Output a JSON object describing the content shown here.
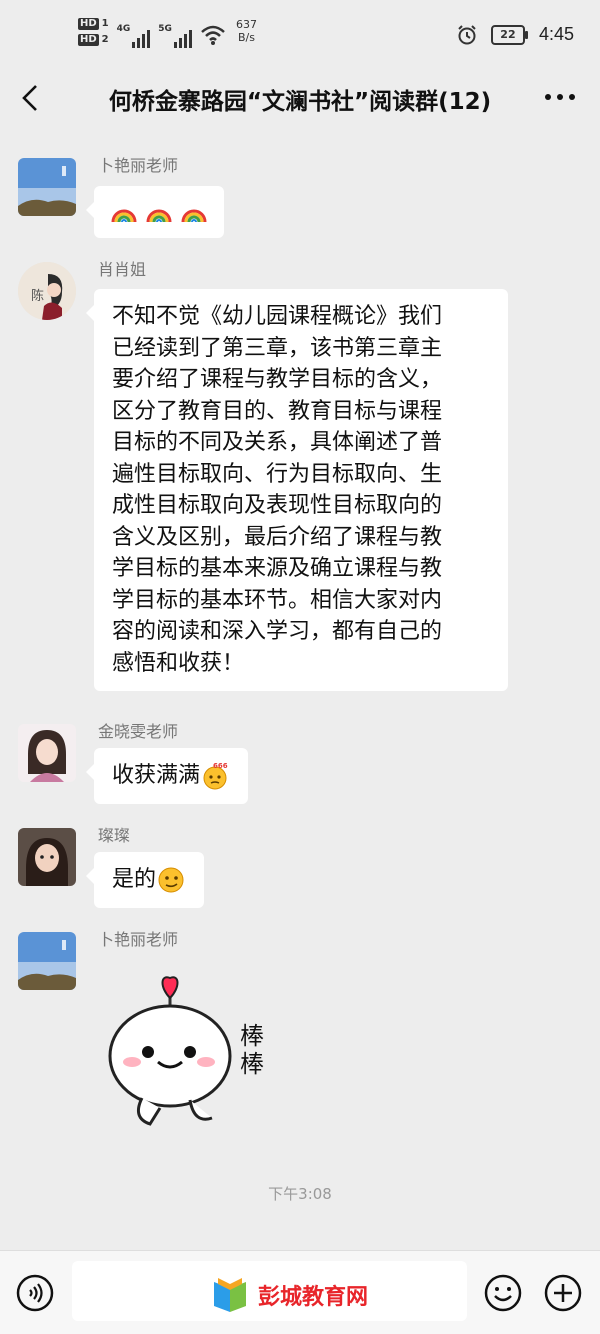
{
  "status_bar": {
    "hd1": "HD",
    "hd1_num": "1",
    "hd2": "HD",
    "hd2_num": "2",
    "net1": "4G",
    "net2": "5G",
    "speed_value": "637",
    "speed_unit": "B/s",
    "battery": "22",
    "time": "4:45"
  },
  "header": {
    "title": "何桥金寨路园“文澜书社”阅读群(12)"
  },
  "messages": [
    {
      "sender": "卜艳丽老师",
      "text": "",
      "emoji": [
        "rainbow-icon",
        "rainbow-icon",
        "rainbow-icon"
      ]
    },
    {
      "sender": "肖肖姐",
      "lines": [
        "不知不觉《幼儿园课程概论》我们",
        "已经读到了第三章，该书第三章主",
        "要介绍了课程与教学目标的含义，",
        "区分了教育目的、教育目标与课程",
        "目标的不同及关系，具体阐述了普",
        "遍性目标取向、行为目标取向、生",
        "成性目标取向及表现性目标取向的",
        "含义及区别，最后介绍了课程与教",
        "学目标的基本来源及确立课程与教",
        "学目标的基本环节。相信大家对内",
        "容的阅读和深入学习，都有自己的",
        "感悟和收获！"
      ],
      "avatar_text": "陈"
    },
    {
      "sender": "金晓雯老师",
      "text": "收获满满",
      "emoji_badge": "666"
    },
    {
      "sender": "璨璨",
      "text": "是的"
    },
    {
      "sender": "卜艳丽老师",
      "sticker_text": "棒\n棒"
    }
  ],
  "time_label": "下午3:08",
  "watermark_text": "彭城教育网",
  "colors": {
    "background": "#ededed",
    "bubble": "#ffffff",
    "sticker_heart": "#ff2d55",
    "watermark": "#e8252a"
  }
}
